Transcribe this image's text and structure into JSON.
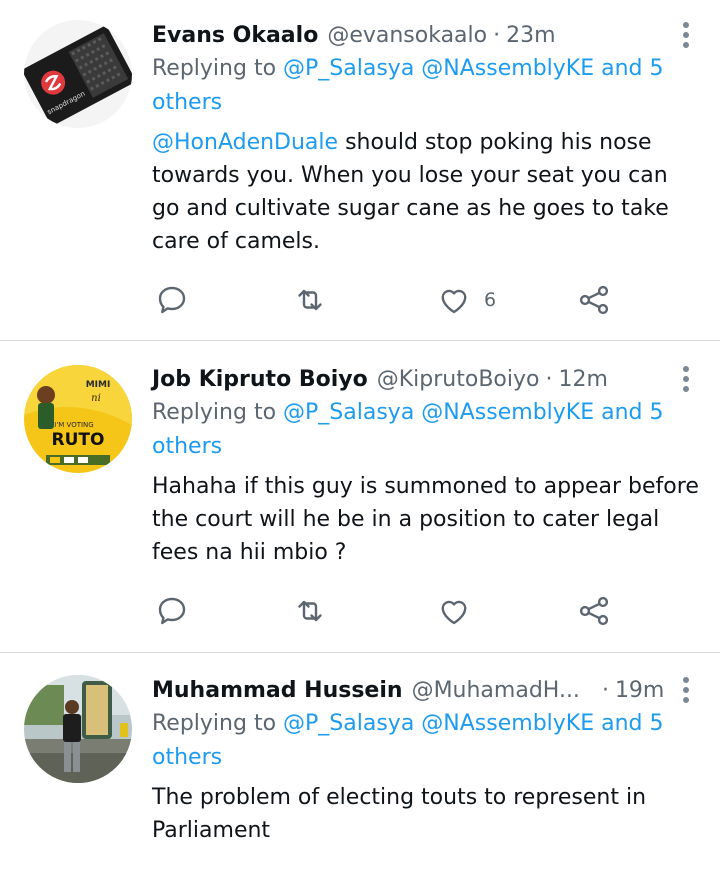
{
  "tweets": [
    {
      "name": "Evans Okaalo",
      "handle": "@evansokaalo",
      "dot": "·",
      "time": "23m",
      "reply_prefix": "Replying to ",
      "reply_to": "@P_Salasya @NAssemblyKE and 5 others",
      "mention": "@HonAdenDuale",
      "text": " should stop poking his nose towards you. When you lose your seat you can go and cultivate sugar cane as he goes to take care of camels.",
      "like_count": "6",
      "avatar_text": "snapdragon"
    },
    {
      "name": "Job Kipruto Boiyo",
      "handle": "@KiprutoBoiyo",
      "dot": "·",
      "time": "12m",
      "reply_prefix": "Replying to ",
      "reply_to": "@P_Salasya @NAssemblyKE and 5 others",
      "text": "Hahaha if this guy is summoned to appear before the court will he be in a position to cater legal fees na hii mbio ?",
      "like_count": "",
      "avatar_text_top": "MIMI",
      "avatar_text_mid": "I'M VOTING",
      "avatar_text_main": "RUTO"
    },
    {
      "name": "Muhammad Hussein",
      "handle": "@MuhamadH...",
      "dot": "·",
      "time": "19m",
      "reply_prefix": "Replying to ",
      "reply_to": "@P_Salasya @NAssemblyKE and 5 others",
      "text": "The problem of electing touts to represent in Parliament"
    }
  ],
  "icons": {
    "reply": "reply-icon",
    "retweet": "retweet-icon",
    "like": "like-icon",
    "share": "share-icon",
    "more": "more-options-icon"
  },
  "colors": {
    "link": "#1d9bf0",
    "secondary_text": "#5b6670",
    "primary_text": "#0f1419",
    "divider": "#d8dde2"
  }
}
